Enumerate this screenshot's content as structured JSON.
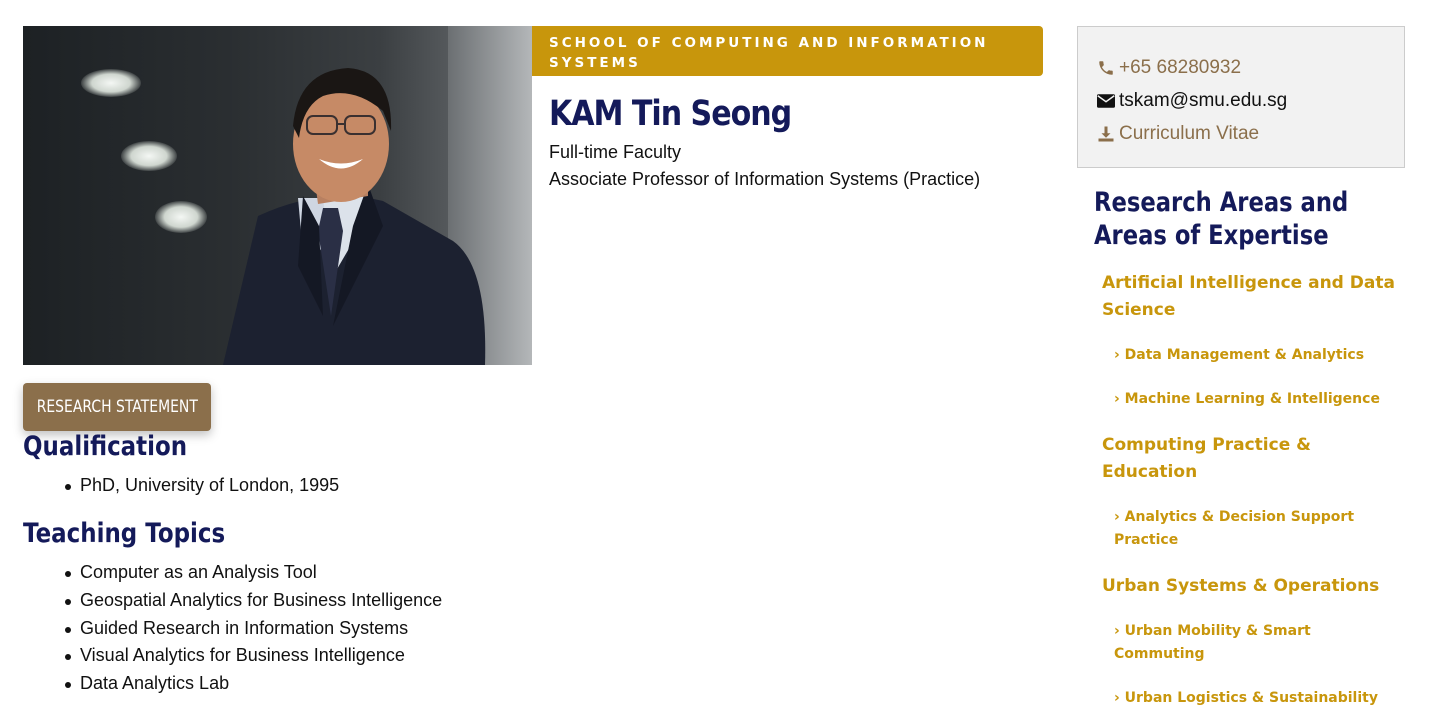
{
  "photo": {
    "alt": "Portrait of KAM Tin Seong"
  },
  "school": {
    "label": "SCHOOL OF COMPUTING AND INFORMATION SYSTEMS"
  },
  "profile": {
    "name": "KAM Tin Seong",
    "role1": "Full-time Faculty",
    "role2": "Associate Professor of Information Systems (Practice)"
  },
  "buttons": {
    "research_statement": "RESEARCH STATEMENT"
  },
  "qualification": {
    "title": "Qualification",
    "items": [
      "PhD, University of London, 1995"
    ]
  },
  "teaching": {
    "title": "Teaching Topics",
    "items": [
      "Computer as an Analysis Tool",
      "Geospatial Analytics for Business Intelligence",
      "Guided Research in Information Systems",
      "Visual Analytics for Business Intelligence",
      "Data Analytics Lab"
    ]
  },
  "contact": {
    "phone": "+65 68280932",
    "email": "tskam@smu.edu.sg",
    "cv": "Curriculum Vitae",
    "icons": [
      "phone-icon",
      "envelope-icon",
      "download-icon"
    ]
  },
  "research_areas": {
    "title": "Research Areas and Areas of Expertise",
    "cat1": "Artificial Intelligence and Data Science",
    "cat1_sub1": "› Data Management & Analytics",
    "cat1_sub2": "› Machine Learning & Intelligence",
    "cat2": "Computing Practice & Education",
    "cat2_sub1": "› Analytics & Decision Support Practice",
    "cat3": "Urban Systems & Operations",
    "cat3_sub1": "› Urban Mobility & Smart Commuting",
    "cat3_sub2": "› Urban Logistics & Sustainability"
  },
  "colors": {
    "navy": "#141a5a",
    "gold": "#c8960c",
    "brown": "#8b6f4b"
  }
}
